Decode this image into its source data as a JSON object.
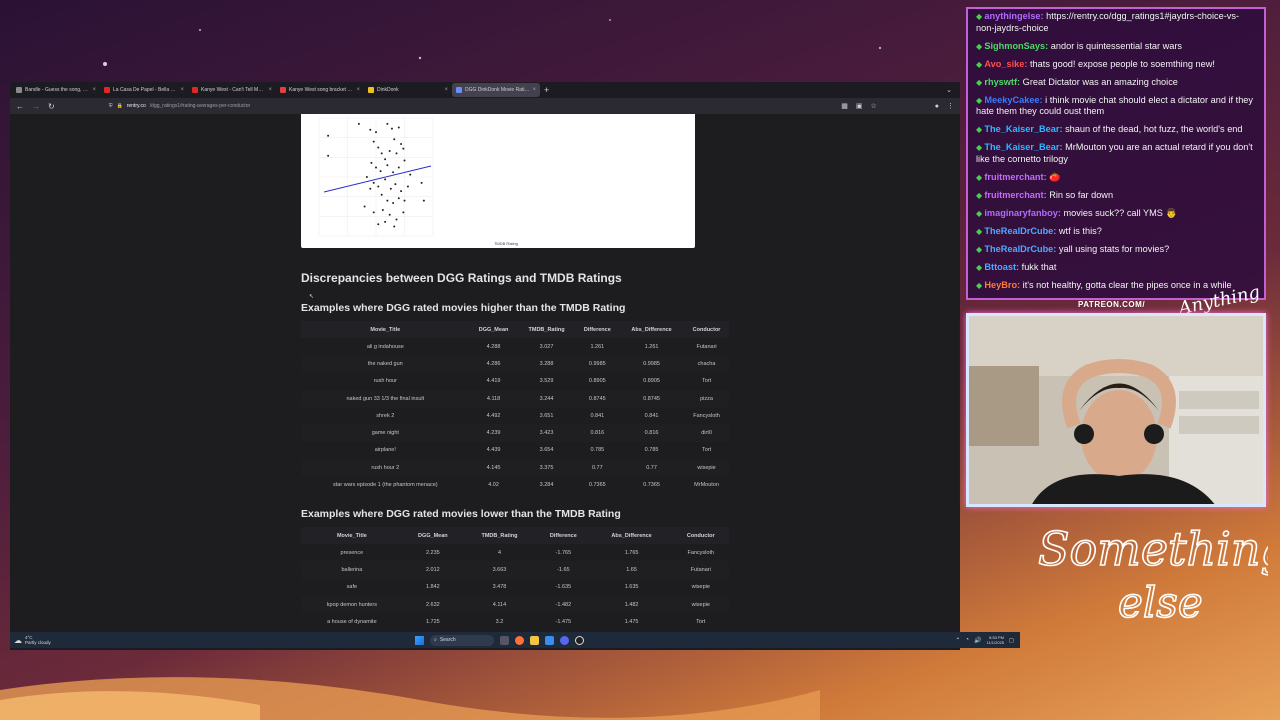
{
  "browser": {
    "tabs": [
      {
        "label": "Bandle - Guess the song, one i",
        "color": "#8a8a8a"
      },
      {
        "label": "La Casa De Papel - Bella Ciao (L",
        "color": "#e12626"
      },
      {
        "label": "Kanye West - Can't Tell Me Not",
        "color": "#e12626"
      },
      {
        "label": "Kanye West song bracket | Use",
        "color": "#e24040"
      },
      {
        "label": "DinkDonk",
        "color": "#f0c020"
      },
      {
        "label": "DGG DinkDonk Movie Rating S",
        "color": "#6a8cff"
      }
    ],
    "new_tab": "+",
    "tab_close": "×",
    "url_host": "rentry.co",
    "url_path": "/dgg_ratings1#rating-averages-per-conductor",
    "tab_menu": "⌄"
  },
  "page": {
    "heading_discrepancies": "Discrepancies between DGG Ratings and TMDB Ratings",
    "heading_higher": "Examples where DGG rated movies higher than the TMDB Rating",
    "heading_lower": "Examples where DGG rated movies lower than the TMDB Rating",
    "scatter": {
      "xlabel": "TMDB Rating",
      "points": [
        [
          0.08,
          0.15
        ],
        [
          0.08,
          0.32
        ],
        [
          0.35,
          0.05
        ],
        [
          0.45,
          0.1
        ],
        [
          0.48,
          0.2
        ],
        [
          0.5,
          0.12
        ],
        [
          0.52,
          0.25
        ],
        [
          0.6,
          0.05
        ],
        [
          0.64,
          0.09
        ],
        [
          0.66,
          0.18
        ],
        [
          0.7,
          0.08
        ],
        [
          0.72,
          0.22
        ],
        [
          0.55,
          0.3
        ],
        [
          0.58,
          0.35
        ],
        [
          0.62,
          0.28
        ],
        [
          0.68,
          0.3
        ],
        [
          0.74,
          0.26
        ],
        [
          0.46,
          0.38
        ],
        [
          0.5,
          0.42
        ],
        [
          0.54,
          0.45
        ],
        [
          0.6,
          0.4
        ],
        [
          0.65,
          0.46
        ],
        [
          0.7,
          0.42
        ],
        [
          0.75,
          0.36
        ],
        [
          0.8,
          0.48
        ],
        [
          0.42,
          0.5
        ],
        [
          0.48,
          0.55
        ],
        [
          0.52,
          0.58
        ],
        [
          0.58,
          0.52
        ],
        [
          0.63,
          0.6
        ],
        [
          0.67,
          0.56
        ],
        [
          0.72,
          0.62
        ],
        [
          0.78,
          0.58
        ],
        [
          0.55,
          0.65
        ],
        [
          0.6,
          0.7
        ],
        [
          0.65,
          0.72
        ],
        [
          0.7,
          0.68
        ],
        [
          0.4,
          0.75
        ],
        [
          0.48,
          0.8
        ],
        [
          0.56,
          0.78
        ],
        [
          0.62,
          0.82
        ],
        [
          0.68,
          0.86
        ],
        [
          0.74,
          0.8
        ],
        [
          0.52,
          0.9
        ],
        [
          0.58,
          0.88
        ],
        [
          0.66,
          0.92
        ],
        [
          0.45,
          0.6
        ],
        [
          0.75,
          0.7
        ],
        [
          0.9,
          0.55
        ],
        [
          0.92,
          0.7
        ]
      ],
      "x_ticks": [
        "",
        "",
        "",
        ""
      ],
      "y_ticks": [
        "",
        "",
        "",
        "",
        "",
        ""
      ]
    },
    "table_higher": {
      "headers": [
        "Movie_Title",
        "DGG_Mean",
        "TMDB_Rating",
        "Difference",
        "Abs_Difference",
        "Conductor"
      ],
      "rows": [
        [
          "ali g indahouse",
          "4.288",
          "3.027",
          "1.261",
          "1.261",
          "Futanari"
        ],
        [
          "the naked gun",
          "4.286",
          "3.288",
          "0.9985",
          "0.9985",
          "chacha"
        ],
        [
          "rush hour",
          "4.419",
          "3.529",
          "0.8905",
          "0.8905",
          "Tort"
        ],
        [
          "naked gun 33 1/3 the final insult",
          "4.118",
          "3.244",
          "0.8745",
          "0.8745",
          "pizza"
        ],
        [
          "shrek 2",
          "4.492",
          "3.651",
          "0.841",
          "0.841",
          "Fancysloth"
        ],
        [
          "game night",
          "4.239",
          "3.423",
          "0.816",
          "0.816",
          "dirt0"
        ],
        [
          "airplane!",
          "4.439",
          "3.654",
          "0.785",
          "0.785",
          "Tort"
        ],
        [
          "rush hour 2",
          "4.145",
          "3.375",
          "0.77",
          "0.77",
          "wisepie"
        ],
        [
          "star wars episode 1 (the phantom menace)",
          "4.02",
          "3.284",
          "0.7365",
          "0.7365",
          "MrMouton"
        ]
      ]
    },
    "table_lower": {
      "headers": [
        "Movie_Title",
        "DGG_Mean",
        "TMDB_Rating",
        "Difference",
        "Abs_Difference",
        "Conductor"
      ],
      "rows": [
        [
          "presence",
          "2.235",
          "4",
          "-1.765",
          "1.765",
          "Fancysloth"
        ],
        [
          "ballerina",
          "2.012",
          "3.663",
          "-1.65",
          "1.65",
          "Futanari"
        ],
        [
          "safe",
          "1.842",
          "3.478",
          "-1.635",
          "1.635",
          "wisepie"
        ],
        [
          "kpop demon hunters",
          "2.632",
          "4.114",
          "-1.482",
          "1.482",
          "wisepie"
        ],
        [
          "a house of dynamite",
          "1.725",
          "3.2",
          "-1.475",
          "1.475",
          "Tort"
        ]
      ]
    }
  },
  "taskbar": {
    "weather_temp": "4°C",
    "weather_desc": "Partly cloudy",
    "search_label": "Search",
    "time": "8:53 PM",
    "date": "11/1/2025"
  },
  "chat": {
    "messages": [
      {
        "user": "anythingelse",
        "user_color": "#b06bff",
        "text": "https://rentry.co/dgg_ratings1#jaydrs-choice-vs-non-jaydrs-choice"
      },
      {
        "user": "SighmonSays",
        "user_color": "#4cd964",
        "text": "andor is quintessential star wars"
      },
      {
        "user": "Avo_sike",
        "user_color": "#ff4f4f",
        "text": "thats good! expose people to soemthing new!"
      },
      {
        "user": "rhyswtf",
        "user_color": "#4cd964",
        "text": "Great Dictator was an amazing choice"
      },
      {
        "user": "MeekyCakee",
        "user_color": "#3a7bff",
        "text": "i think movie chat should elect a dictator and if they hate them they could oust them"
      },
      {
        "user": "The_Kaiser_Bear",
        "user_color": "#2fb8ff",
        "text": "shaun of the dead, hot fuzz, the world's end"
      },
      {
        "user": "The_Kaiser_Bear",
        "user_color": "#2fb8ff",
        "text": "MrMouton you are an actual retard if you don't like the cornetto trilogy"
      },
      {
        "user": "fruitmerchant",
        "user_color": "#c46bff",
        "text": "🍅"
      },
      {
        "user": "fruitmerchant",
        "user_color": "#c46bff",
        "text": "Rin so far down"
      },
      {
        "user": "imaginaryfanboy",
        "user_color": "#b06bff",
        "text": "movies suck?? call YMS 👨"
      },
      {
        "user": "TheRealDrCube",
        "user_color": "#4fa8ff",
        "text": "wtf is this?"
      },
      {
        "user": "TheRealDrCube",
        "user_color": "#4fa8ff",
        "text": "yall using stats for movies?"
      },
      {
        "user": "Bttoast",
        "user_color": "#4fa8ff",
        "text": "fukk that"
      },
      {
        "user": "HeyBro",
        "user_color": "#ff7a3a",
        "text": "it's not healthy, gotta clear the pipes once in a while"
      }
    ]
  },
  "overlay": {
    "patreon": "PATREON.COM/",
    "brand_corner": "Anything else",
    "brand_script_1": "Something",
    "brand_script_2": "else"
  }
}
